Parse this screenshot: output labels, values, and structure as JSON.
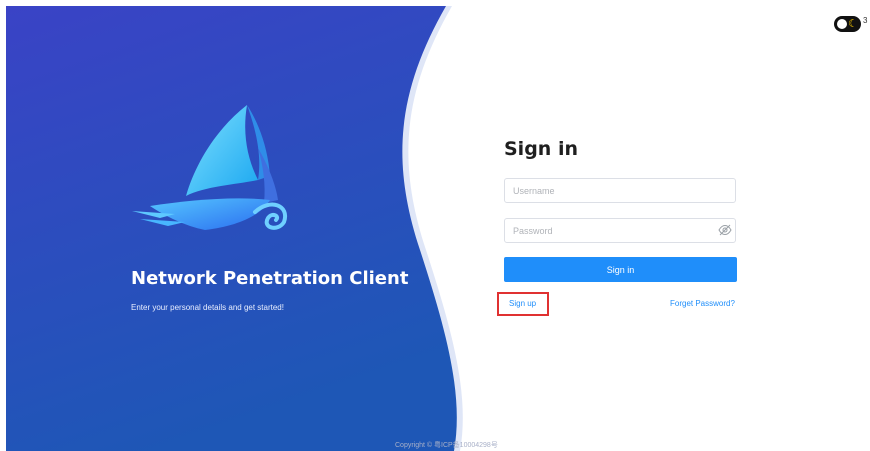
{
  "hero": {
    "title": "Network Penetration Client",
    "subtitle": "Enter your personal details and get started!",
    "logo": "sailboat-logo-icon"
  },
  "theme_toggle": {
    "icon": "moon-icon",
    "extra_label": "3",
    "state": "light"
  },
  "signin": {
    "title": "Sign in",
    "username_placeholder": "Username",
    "password_placeholder": "Password",
    "password_visibility_icon": "eye-off-icon",
    "submit_label": "Sign in",
    "signup_label": "Sign up",
    "forgot_label": "Forget Password?"
  },
  "footer": {
    "text": "Copyright © 粤ICP备10004298号"
  },
  "colors": {
    "hero_gradient_top": "#3a47c4",
    "hero_gradient_bottom": "#1f56b5",
    "primary": "#1f8efa",
    "highlight_box": "#e03131"
  }
}
